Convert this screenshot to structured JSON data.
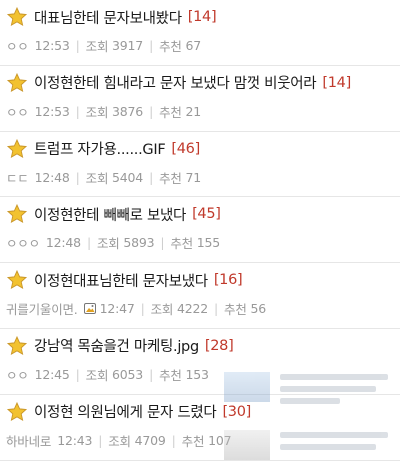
{
  "posts": [
    {
      "title": "대표님한테 문자보내봤다",
      "count": "[14]",
      "author": "ㅇㅇ",
      "time": "12:53",
      "views_label": "조회",
      "views": "3917",
      "recommend_label": "추천",
      "recommend": "67",
      "has_image_icon": false
    },
    {
      "title": "이정현한테 힘내라고 문자 보냈다 맘껏 비웃어라",
      "count": "[14]",
      "author": "ㅇㅇ",
      "time": "12:53",
      "views_label": "조회",
      "views": "3876",
      "recommend_label": "추천",
      "recommend": "21",
      "has_image_icon": false
    },
    {
      "title": "트럼프 자가용......GIF",
      "count": "[46]",
      "author": "ㄷㄷ",
      "time": "12:48",
      "views_label": "조회",
      "views": "5404",
      "recommend_label": "추천",
      "recommend": "71",
      "has_image_icon": false
    },
    {
      "title": "이정현한테 빼빼로 보냈다",
      "count": "[45]",
      "author": "ㅇㅇㅇ",
      "time": "12:48",
      "views_label": "조회",
      "views": "5893",
      "recommend_label": "추천",
      "recommend": "155",
      "has_image_icon": false
    },
    {
      "title": "이정현대표님한테 문자보냈다",
      "count": "[16]",
      "author": "귀를기울이면.",
      "time": "12:47",
      "views_label": "조회",
      "views": "4222",
      "recommend_label": "추천",
      "recommend": "56",
      "has_image_icon": true
    },
    {
      "title": "강남역 목숨을건 마케팅.jpg",
      "count": "[28]",
      "author": "ㅇㅇ",
      "time": "12:45",
      "views_label": "조회",
      "views": "6053",
      "recommend_label": "추천",
      "recommend": "153",
      "has_image_icon": false
    },
    {
      "title": "이정현 의원님에게 문자 드렸다",
      "count": "[30]",
      "author": "하바네로",
      "time": "12:43",
      "views_label": "조회",
      "views": "4709",
      "recommend_label": "추천",
      "recommend": "107",
      "has_image_icon": false
    }
  ],
  "colors": {
    "count": "#c0392b",
    "meta": "#999999",
    "star_fill": "#f2c230",
    "star_stroke": "#c9962a"
  },
  "icons": {
    "star": "star-icon",
    "image": "image-icon"
  }
}
